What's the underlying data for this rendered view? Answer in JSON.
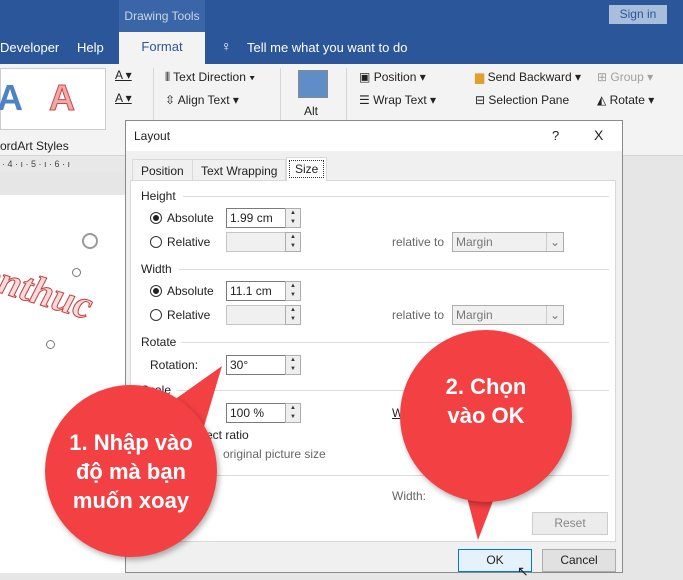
{
  "titlebar": {
    "context_label": "Drawing Tools",
    "sign_in": "Sign in"
  },
  "tabs": {
    "developer": "Developer",
    "help": "Help",
    "format": "Format",
    "tell_me": "Tell me what you want to do"
  },
  "ribbon": {
    "wordart_group": "ordArt Styles",
    "text_direction": "Text Direction",
    "align_text": "Align Text",
    "alt": "Alt",
    "position": "Position",
    "wrap_text": "Wrap Text",
    "send_backward": "Send Backward",
    "selection_pane": "Selection Pane",
    "group": "Group",
    "rotate": "Rotate",
    "ruler": "· 4 · ı · 5 · ı · 6 · ı"
  },
  "document": {
    "wordart_text": "ienthuc"
  },
  "dialog": {
    "title": "Layout",
    "help": "?",
    "close": "X",
    "tabs": [
      "Position",
      "Text Wrapping",
      "Size"
    ],
    "active_tab": "Size",
    "height": {
      "label": "Height",
      "absolute_label": "Absolute",
      "absolute_value": "1.99 cm",
      "relative_label": "Relative",
      "relative_to": "relative to",
      "relative_to_value": "Margin",
      "selected": "absolute"
    },
    "width": {
      "label": "Width",
      "absolute_label": "Absolute",
      "absolute_value": "11.1 cm",
      "relative_label": "Relative",
      "relative_to": "relative to",
      "relative_to_value": "Margin",
      "selected": "absolute"
    },
    "rotate": {
      "label": "Rotate",
      "rotation_label": "Rotation:",
      "rotation_value": "30°"
    },
    "scale": {
      "label": "Scale",
      "height_value": "100 %",
      "width_label_partial": "W",
      "lock_partial": "ect ratio",
      "original_partial": "original picture size"
    },
    "original": {
      "width_label": "Width:"
    },
    "reset": "Reset",
    "ok": "OK",
    "cancel": "Cancel"
  },
  "callouts": {
    "step1": "1. Nhập vào độ mà bạn muốn xoay",
    "step2": "2. Chọn vào OK"
  },
  "colors": {
    "ribbon_blue": "#2b579a",
    "callout_red": "#f34043"
  }
}
